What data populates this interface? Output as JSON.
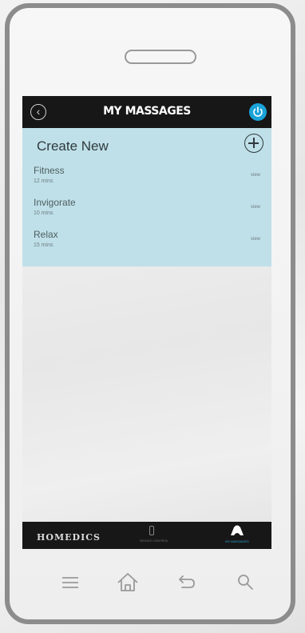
{
  "header": {
    "title": "MY MASSAGES",
    "back_icon": "back-circle-icon",
    "power_icon": "power-icon",
    "power_color": "#1aa3d9"
  },
  "create": {
    "label": "Create New",
    "add_icon": "plus-circle-icon"
  },
  "massages": [
    {
      "name": "Fitness",
      "duration": "12 mins",
      "action": "view"
    },
    {
      "name": "Invigorate",
      "duration": "10 mins",
      "action": "view"
    },
    {
      "name": "Relax",
      "duration": "15 mins",
      "action": "view"
    }
  ],
  "tabbar": {
    "brand": "HOMEDICS",
    "tabs": [
      {
        "label": "DEVICE CONTROL",
        "icon": "device-remote-icon",
        "active": false
      },
      {
        "label": "MY MASSAGES",
        "icon": "massage-chair-icon",
        "active": true
      }
    ],
    "active_color": "#29a8d8"
  },
  "system_nav": {
    "icons": [
      "menu-icon",
      "home-icon",
      "back-arrow-icon",
      "search-icon"
    ]
  },
  "colors": {
    "list_background": "#bfe0e8",
    "bar_background": "#171717"
  }
}
